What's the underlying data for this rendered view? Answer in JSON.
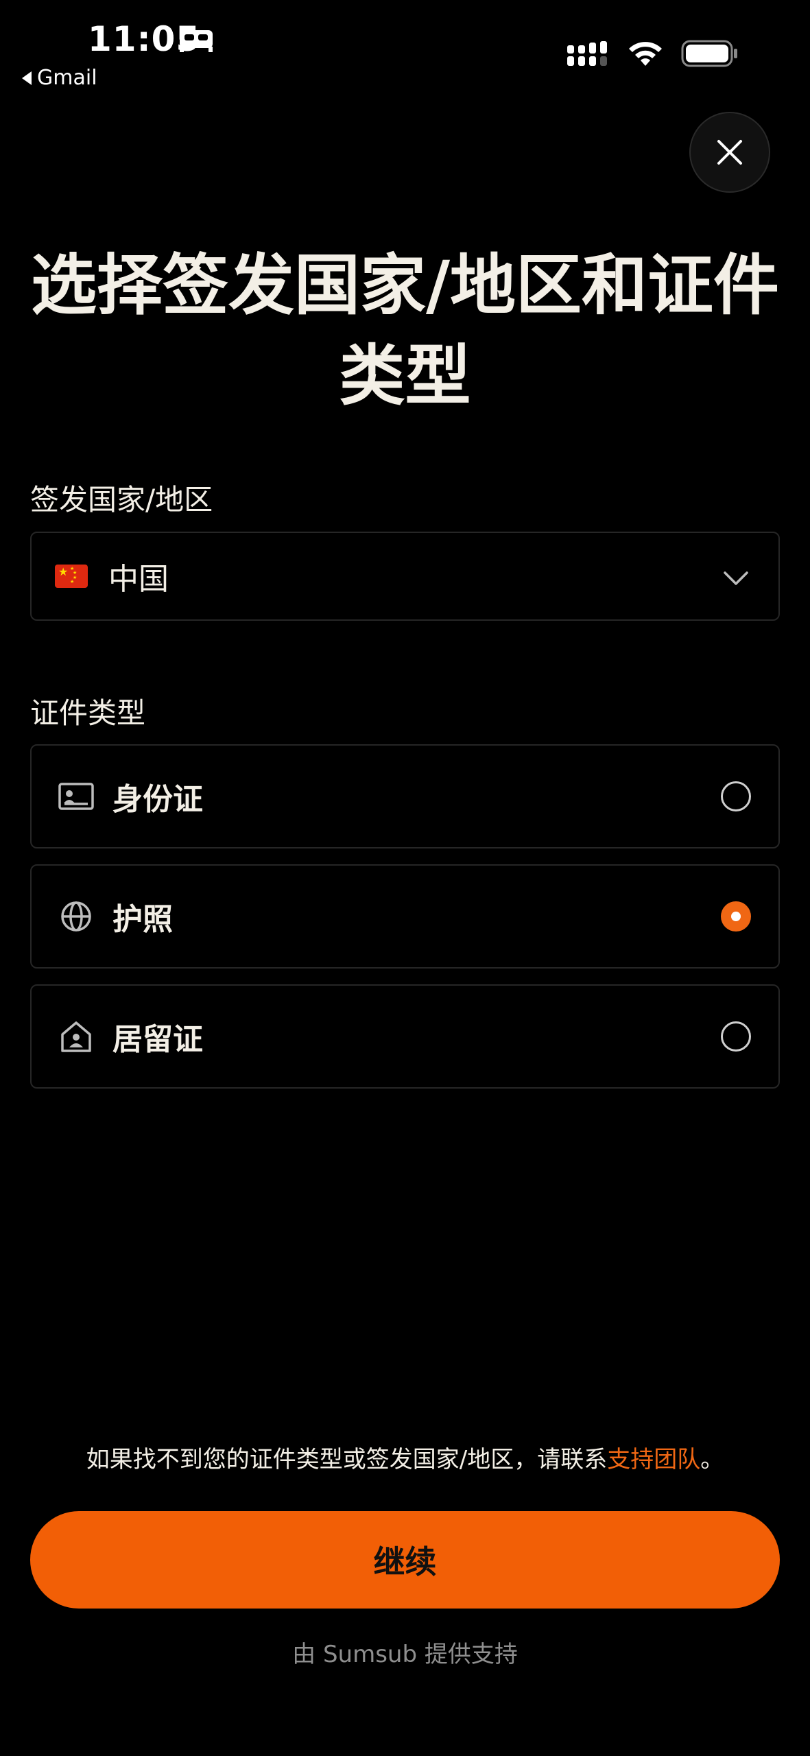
{
  "status_bar": {
    "time": "11:05",
    "back_app": "Gmail"
  },
  "title": "选择签发国家/地区和证件类型",
  "country": {
    "label": "签发国家/地区",
    "selected": "中国",
    "flag_icon": "china-flag-icon"
  },
  "document_type": {
    "label": "证件类型",
    "options": [
      {
        "label": "身份证",
        "icon": "id-card-icon",
        "selected": false
      },
      {
        "label": "护照",
        "icon": "globe-icon",
        "selected": true
      },
      {
        "label": "居留证",
        "icon": "residence-permit-icon",
        "selected": false
      }
    ]
  },
  "help": {
    "text": "如果找不到您的证件类型或签发国家/地区，请联系",
    "link": "支持团队",
    "suffix": "。"
  },
  "continue_label": "继续",
  "powered_by": "由 Sumsub 提供支持",
  "colors": {
    "accent": "#f25f06",
    "background": "#000000",
    "text": "#f3efe6"
  }
}
